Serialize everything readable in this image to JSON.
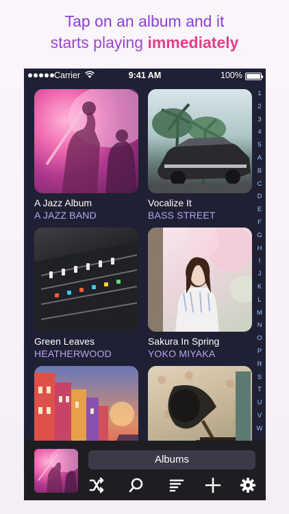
{
  "headline": {
    "line1": "Tap on an album and it",
    "line2_start": "starts playing ",
    "line2_emphasis": "immediately"
  },
  "status_bar": {
    "carrier": "Carrier",
    "time": "9:41 AM",
    "battery": "100%"
  },
  "albums": [
    {
      "title": "A Jazz Album",
      "artist": "A JAZZ BAND"
    },
    {
      "title": "Vocalize It",
      "artist": "BASS STREET"
    },
    {
      "title": "Green Leaves",
      "artist": "HEATHERWOOD"
    },
    {
      "title": "Sakura In Spring",
      "artist": "YOKO MIYAKA"
    },
    {
      "title": "",
      "artist": ""
    },
    {
      "title": "",
      "artist": ""
    }
  ],
  "index_letters": [
    "1",
    "2",
    "3",
    "4",
    "5",
    "A",
    "B",
    "C",
    "D",
    "E",
    "F",
    "G",
    "H",
    "I",
    "J",
    "K",
    "L",
    "M",
    "N",
    "O",
    "P",
    "R",
    "S",
    "T",
    "U",
    "V",
    "W"
  ],
  "player": {
    "section_label": "Albums"
  },
  "toolbar": {
    "icons": [
      "shuffle-icon",
      "search-icon",
      "sort-icon",
      "add-icon",
      "settings-icon"
    ]
  },
  "colors": {
    "headline_purple": "#8a3fd8",
    "headline_pink": "#e0408a",
    "app_background": "#1f2033",
    "artist_text": "#b9a6f0",
    "index_text": "#9ec6ff"
  }
}
